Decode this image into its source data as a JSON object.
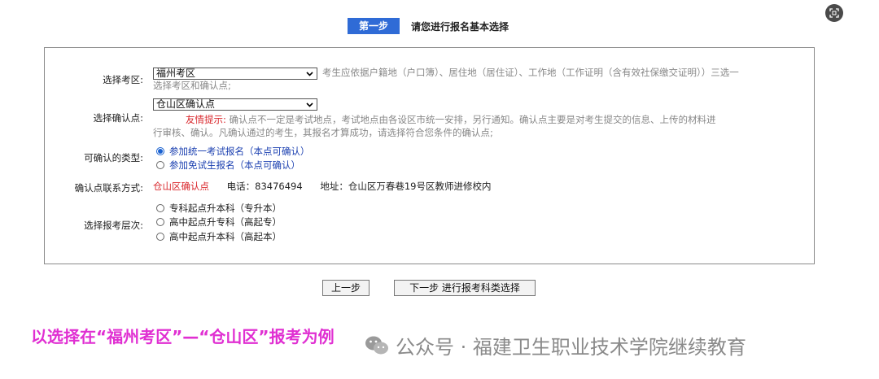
{
  "header": {
    "step_badge": "第一步",
    "title": "请您进行报名基本选择"
  },
  "form": {
    "exam_area": {
      "label": "选择考区:",
      "selected": "福州考区",
      "hint": "考生应依据户籍地（户口簿）、居住地（居住证）、工作地（工作证明（含有效社保缴交证明））三选一选择考区和确认点;"
    },
    "confirm_point": {
      "label": "选择确认点:",
      "selected": "仓山区确认点",
      "tip_label": "友情提示:",
      "tip_line1": "确认点不一定是考试地点，考试地点由各设区市统一安排，另行通知。确认点主要是对考生提交的信息、上传的材料进",
      "tip_line2": "行审核、确认。凡确认通过的考生，其报名才算成功，请选择符合您条件的确认点;"
    },
    "confirm_type": {
      "label": "可确认的类型:",
      "options": [
        "参加统一考试报名（本点可确认）",
        "参加免试生报名（本点可确认）"
      ],
      "checked_index": 0
    },
    "contact": {
      "label": "确认点联系方式:",
      "point_name": "仓山区确认点",
      "phone": "电话：83476494",
      "address": "地址：仓山区万春巷19号区教师进修校内"
    },
    "level": {
      "label": "选择报考层次:",
      "options": [
        "专科起点升本科（专升本）",
        "高中起点升专科（高起专）",
        "高中起点升本科（高起本）"
      ]
    }
  },
  "buttons": {
    "prev": "上一步",
    "next": "下一步 进行报考科类选择"
  },
  "caption": "以选择在“福州考区”—“仓山区”报考为例",
  "watermark": "公众号 · 福建卫生职业技术学院继续教育",
  "colors": {
    "accent_blue": "#2f6bd6",
    "tip_red": "#d9262b",
    "caption_magenta": "#e02fd2"
  }
}
